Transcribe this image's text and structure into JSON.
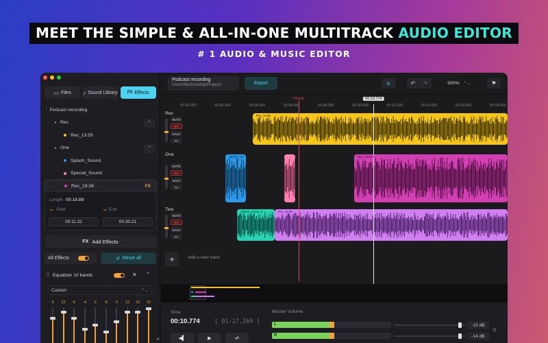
{
  "hero": {
    "headline_main": "MEET THE SIMPLE & ALL-IN-ONE MULTITRACK ",
    "headline_accent": "AUDIO EDITOR",
    "subheadline": "# 1 AUDIO & MUSIC EDITOR"
  },
  "colors": {
    "accent_cyan": "#4ed2ee",
    "accent_orange": "#f0a33c",
    "clip_yellow": "#f5c518",
    "clip_magenta": "#d23fb3",
    "clip_blue": "#2c9ae8",
    "clip_pink": "#ff7fb2",
    "clip_teal": "#27d3b2",
    "clip_violet": "#cf7ff0",
    "playhead_red": "#e0484a"
  },
  "sidebar": {
    "tabs": [
      {
        "label": "Files",
        "icon": "folder-icon"
      },
      {
        "label": "Sound Library",
        "icon": "music-icon"
      },
      {
        "label": "Effects",
        "icon": "fx-icon",
        "icon_text": "FX"
      }
    ],
    "project_name": "Podcast recording",
    "tree": [
      {
        "type": "group",
        "label": "Rec"
      },
      {
        "type": "file",
        "label": "Rec_13:55",
        "color": "#f5c518"
      },
      {
        "type": "group",
        "label": "One"
      },
      {
        "type": "file",
        "label": "Splash_Sound",
        "color": "#2c9ae8"
      },
      {
        "type": "file",
        "label": "Special_Sound",
        "color": "#ff7fb2"
      },
      {
        "type": "file",
        "label": "Rec_19:26",
        "color": "#d23fb3",
        "selected": true,
        "badge": "FX"
      }
    ],
    "length_label": "Length",
    "length_value": "00:18.89",
    "start_label": "Start",
    "end_label": "End",
    "start_value": "00:11.31",
    "end_value": "00:30.21",
    "add_effects": "Add Effects",
    "add_effects_icon": "FX",
    "all_effects": "All Effects",
    "reset_all": "Reset all",
    "equalizer_title": "Equalizer 10 bands",
    "equalizer_preset": "Custom",
    "eq_bands": [
      6,
      12,
      6,
      -4,
      0,
      -6,
      3,
      12,
      12,
      15
    ],
    "eq_range": [
      -15,
      15
    ]
  },
  "toolbar": {
    "project_title": "Podcast recording",
    "project_path": "Users/Me/Desktop/Projects",
    "export_label": "Export",
    "zoom_label": "500%"
  },
  "timeline": {
    "ticks": [
      "00:00.000",
      "00:02.000",
      "00:04.000",
      "00:06.000",
      "00:08.000",
      "00:10.000",
      "00:12.000",
      "00:14.000",
      "00:16.000",
      "00:18.000"
    ],
    "playhead_label": "00:10.774",
    "volume_marker_label": "Volume"
  },
  "tracks": [
    {
      "name": "Rec",
      "mute": "MUTE",
      "rec": "REC",
      "solo": "SOLO",
      "fx": "FX",
      "clips": [
        {
          "label": "Rec_13:55",
          "color": "#f5c518"
        }
      ]
    },
    {
      "name": "One",
      "mute": "MUTE",
      "rec": "REC",
      "solo": "SOLO",
      "fx": "FX",
      "clips": [
        {
          "label": "Splash_sou",
          "color": "#2c9ae8"
        },
        {
          "label": "",
          "color": "#ff7fb2"
        },
        {
          "label": "Rec_19:26",
          "color": "#d23fb3"
        }
      ]
    },
    {
      "name": "Two",
      "mute": "MUTE",
      "rec": "REC",
      "solo": "SOLO",
      "fx": "FX",
      "clips": [
        {
          "label": "Splash_sound_2",
          "color": "#27d3b2"
        },
        {
          "label": "Rec_14:55",
          "color": "#cf7ff0"
        }
      ]
    }
  ],
  "add_track_label": "Add a new track",
  "transport": {
    "time_label": "Time",
    "current_time": "00:10.774",
    "total_time": "[ 01:27.269 ]"
  },
  "master": {
    "label": "Master Volume",
    "left_channel": "L",
    "right_channel": "R",
    "left_level": 0.48,
    "right_level": 0.48,
    "left_db": "-15 dB",
    "right_db": "-14 dB",
    "left_gain": 0.95,
    "right_gain": 0.95
  }
}
